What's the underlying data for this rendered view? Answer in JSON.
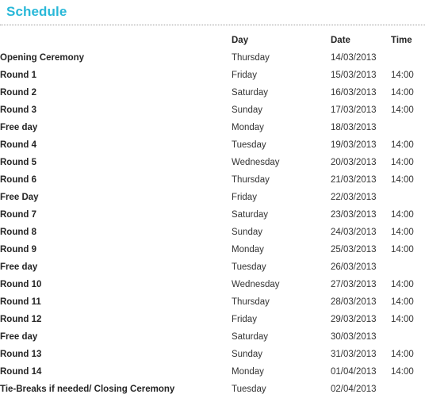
{
  "title": "Schedule",
  "table": {
    "headers": {
      "event": "",
      "day": "Day",
      "date": "Date",
      "time": "Time"
    },
    "rows": [
      {
        "event": "Opening Ceremony",
        "day": "Thursday",
        "date": "14/03/2013",
        "time": ""
      },
      {
        "event": "Round 1",
        "day": "Friday",
        "date": "15/03/2013",
        "time": "14:00"
      },
      {
        "event": "Round 2",
        "day": "Saturday",
        "date": "16/03/2013",
        "time": "14:00"
      },
      {
        "event": "Round 3",
        "day": "Sunday",
        "date": "17/03/2013",
        "time": "14:00"
      },
      {
        "event": "Free day",
        "day": "Monday",
        "date": "18/03/2013",
        "time": ""
      },
      {
        "event": "Round 4",
        "day": "Tuesday",
        "date": "19/03/2013",
        "time": "14:00"
      },
      {
        "event": "Round 5",
        "day": "Wednesday",
        "date": "20/03/2013",
        "time": "14:00"
      },
      {
        "event": "Round 6",
        "day": "Thursday",
        "date": "21/03/2013",
        "time": "14:00"
      },
      {
        "event": "Free Day",
        "day": "Friday",
        "date": "22/03/2013",
        "time": ""
      },
      {
        "event": "Round 7",
        "day": "Saturday",
        "date": "23/03/2013",
        "time": "14:00"
      },
      {
        "event": "Round 8",
        "day": "Sunday",
        "date": "24/03/2013",
        "time": "14:00"
      },
      {
        "event": "Round 9",
        "day": "Monday",
        "date": "25/03/2013",
        "time": "14:00"
      },
      {
        "event": "Free day",
        "day": "Tuesday",
        "date": "26/03/2013",
        "time": ""
      },
      {
        "event": "Round 10",
        "day": "Wednesday",
        "date": "27/03/2013",
        "time": "14:00"
      },
      {
        "event": "Round 11",
        "day": "Thursday",
        "date": "28/03/2013",
        "time": "14:00"
      },
      {
        "event": "Round 12",
        "day": "Friday",
        "date": "29/03/2013",
        "time": "14:00"
      },
      {
        "event": "Free day",
        "day": "Saturday",
        "date": "30/03/2013",
        "time": ""
      },
      {
        "event": "Round 13",
        "day": "Sunday",
        "date": "31/03/2013",
        "time": "14:00"
      },
      {
        "event": "Round 14",
        "day": "Monday",
        "date": "01/04/2013",
        "time": "14:00"
      },
      {
        "event": "Tie-Breaks if needed/ Closing Ceremony",
        "day": "Tuesday",
        "date": "02/04/2013",
        "time": ""
      }
    ]
  },
  "colors": {
    "title": "#29b8d8",
    "text": "#252525",
    "divider": "#9a9a9a"
  }
}
